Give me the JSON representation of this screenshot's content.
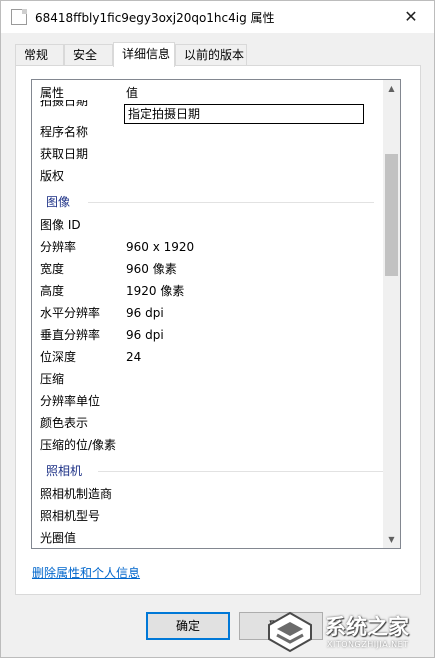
{
  "window": {
    "title": "68418ffbly1fic9egy3oxj20qo1hc4ig 属性",
    "close_glyph": "✕"
  },
  "tabs": [
    {
      "label": "常规"
    },
    {
      "label": "安全"
    },
    {
      "label": "详细信息"
    },
    {
      "label": "以前的版本"
    }
  ],
  "list": {
    "header": {
      "key": "属性",
      "value": "值"
    },
    "partial_row": {
      "key": "拍摄日期",
      "value": "指定拍摄日期"
    },
    "rows_top": [
      {
        "key": "程序名称",
        "value": ""
      },
      {
        "key": "获取日期",
        "value": ""
      },
      {
        "key": "版权",
        "value": ""
      }
    ],
    "group_image": "图像",
    "rows_image": [
      {
        "key": "图像 ID",
        "value": ""
      },
      {
        "key": "分辨率",
        "value": "960 x 1920"
      },
      {
        "key": "宽度",
        "value": "960 像素"
      },
      {
        "key": "高度",
        "value": "1920 像素"
      },
      {
        "key": "水平分辨率",
        "value": "96 dpi"
      },
      {
        "key": "垂直分辨率",
        "value": "96 dpi"
      },
      {
        "key": "位深度",
        "value": "24"
      },
      {
        "key": "压缩",
        "value": ""
      },
      {
        "key": "分辨率单位",
        "value": ""
      },
      {
        "key": "颜色表示",
        "value": ""
      },
      {
        "key": "压缩的位/像素",
        "value": ""
      }
    ],
    "group_camera": "照相机",
    "rows_camera": [
      {
        "key": "照相机制造商",
        "value": ""
      },
      {
        "key": "照相机型号",
        "value": ""
      },
      {
        "key": "光圈值",
        "value": ""
      }
    ]
  },
  "link": {
    "label": "删除属性和个人信息"
  },
  "buttons": {
    "ok": "确定",
    "cancel": "取消"
  },
  "watermark": {
    "text": "系统之家",
    "sub": "XITONGZHIJIA.NET"
  },
  "colors": {
    "accent": "#0078d7",
    "group": "#1e3287",
    "link": "#0066cc"
  }
}
